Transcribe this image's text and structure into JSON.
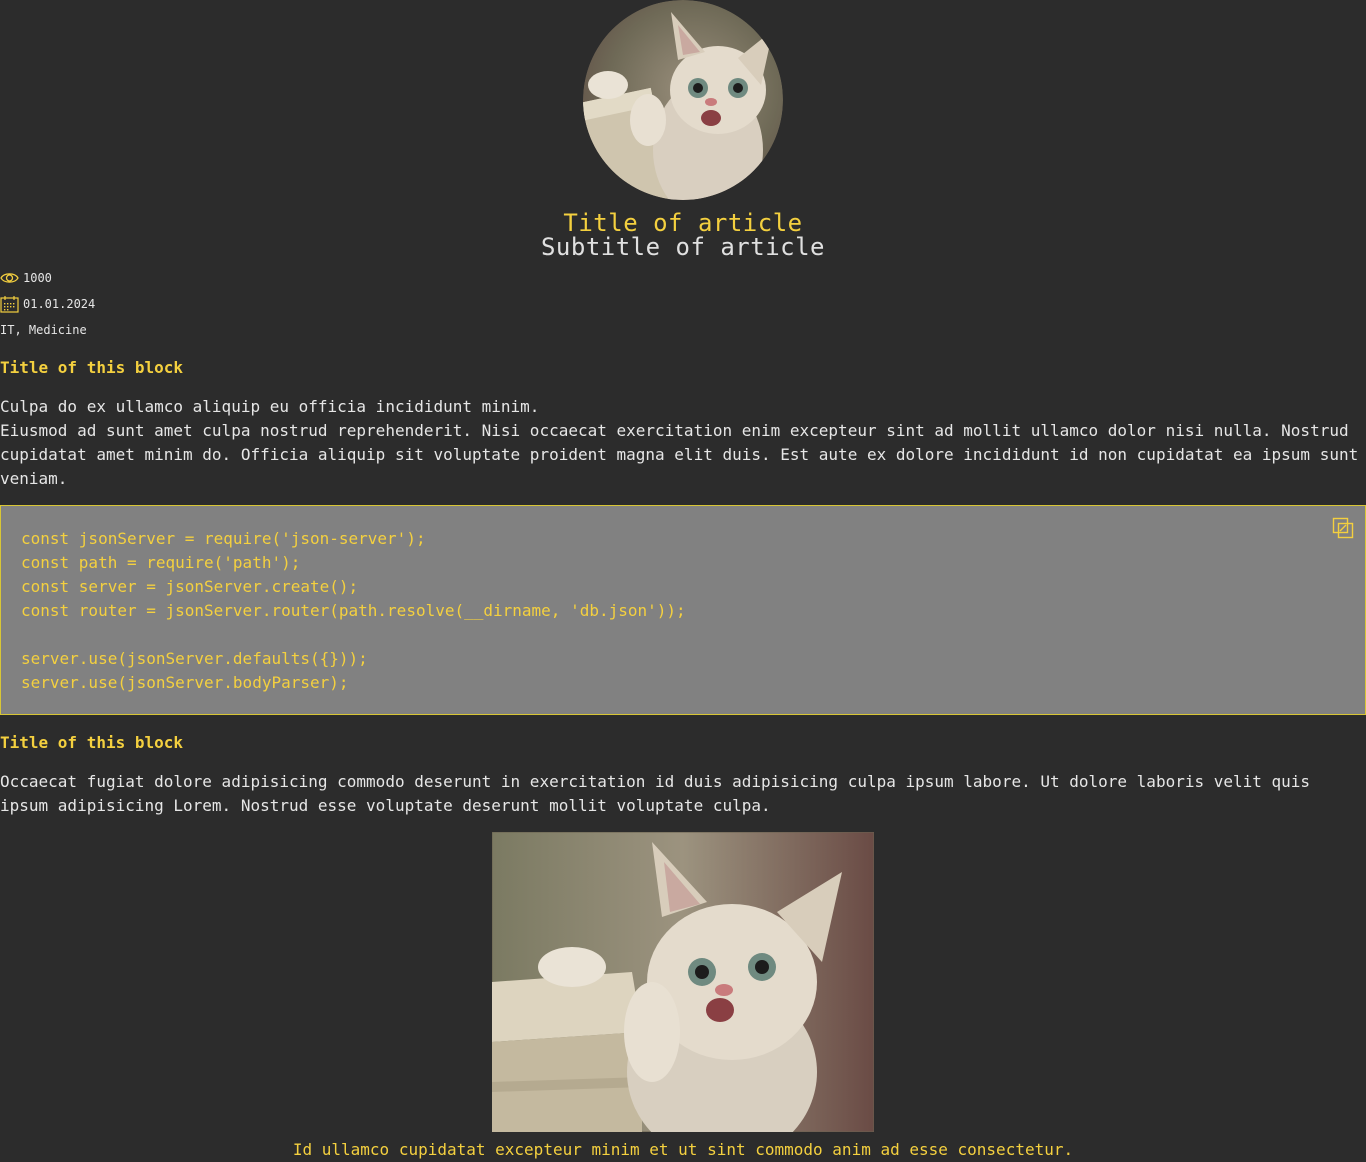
{
  "article": {
    "title": "Title of article",
    "subtitle": "Subtitle of article",
    "views": "1000",
    "date": "01.01.2024",
    "tags": "IT, Medicine"
  },
  "blocks": [
    {
      "title": "Title of this block",
      "paragraphs": [
        "Culpa do ex ullamco aliquip eu officia incididunt minim.",
        "Eiusmod ad sunt amet culpa nostrud reprehenderit. Nisi occaecat exercitation enim excepteur sint ad mollit ullamco dolor nisi nulla. Nostrud cupidatat amet minim do. Officia aliquip sit voluptate proident magna elit duis. Est aute ex dolore incididunt id non cupidatat ea ipsum sunt veniam."
      ]
    },
    {
      "code": "const jsonServer = require('json-server');\nconst path = require('path');\nconst server = jsonServer.create();\nconst router = jsonServer.router(path.resolve(__dirname, 'db.json'));\n\nserver.use(jsonServer.defaults({}));\nserver.use(jsonServer.bodyParser);"
    },
    {
      "title": "Title of this block",
      "paragraphs": [
        "Occaecat fugiat dolore adipisicing commodo deserunt in exercitation id duis adipisicing culpa ipsum labore. Ut dolore laboris velit quis ipsum adipisicing Lorem. Nostrud esse voluptate deserunt mollit voluptate culpa."
      ]
    },
    {
      "caption": "Id ullamco cupidatat excepteur minim et ut sint commodo anim ad esse consectetur."
    }
  ],
  "icons": {
    "views": "eye-icon",
    "date": "calendar-icon",
    "copy": "copy-icon"
  },
  "colors": {
    "background": "#2c2c2c",
    "accent": "#f4d03f",
    "text": "#e6e6e6",
    "code_background": "#818181"
  }
}
